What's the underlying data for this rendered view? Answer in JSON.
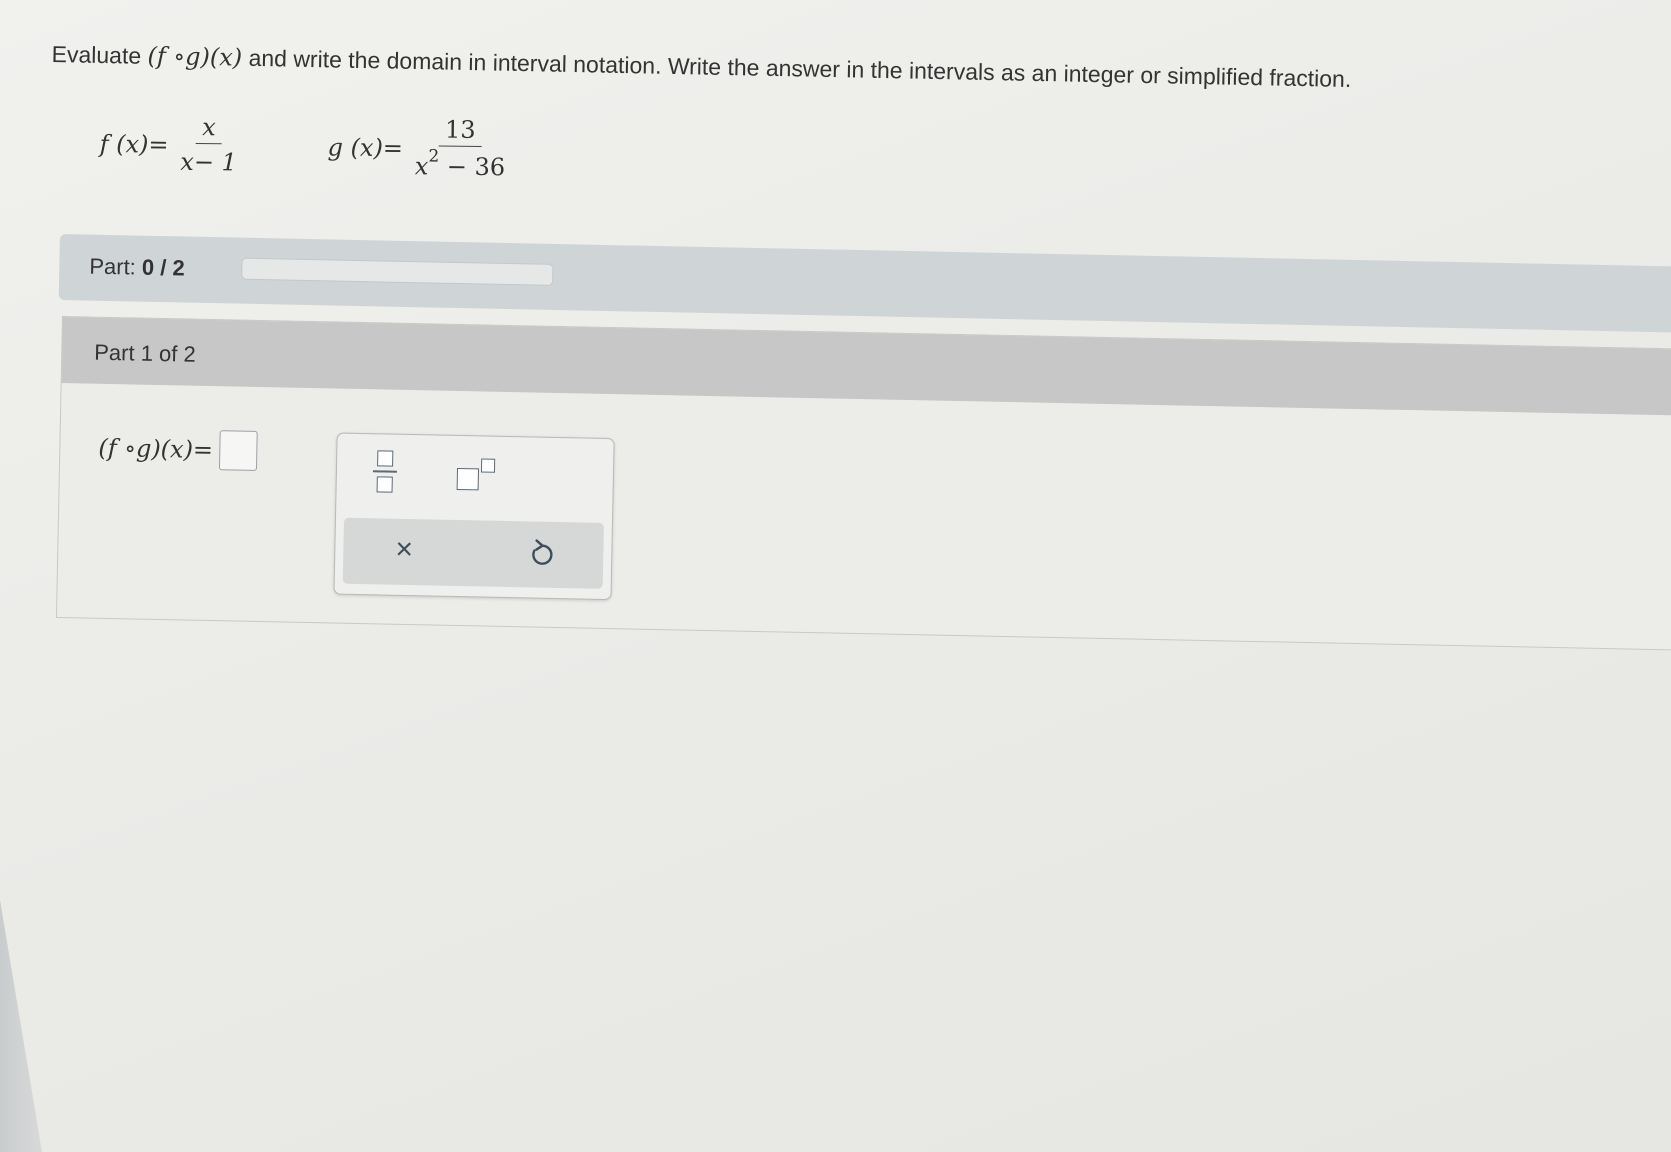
{
  "question": {
    "intro": "Evaluate",
    "composition": "(f ∘g)(x)",
    "text": "and write the domain in interval notation. Write the answer in the intervals as an integer or simplified fraction."
  },
  "formulas": {
    "f_lhs": "f (x)=",
    "f_num": "x",
    "f_den": "x− 1",
    "g_lhs": "g (x)=",
    "g_num": "13",
    "g_den_base": "x",
    "g_den_exp": "2",
    "g_den_rest": " − 36"
  },
  "part_progress": {
    "label": "Part:",
    "value": "0 / 2",
    "fraction": 0
  },
  "part": {
    "title": "Part 1 of 2",
    "answer_label": "(f ∘g)(x)="
  },
  "toolbar": {
    "fraction_icon": "fraction-icon",
    "exponent_icon": "exponent-icon",
    "clear_label": "×",
    "undo_icon": "undo-icon"
  }
}
